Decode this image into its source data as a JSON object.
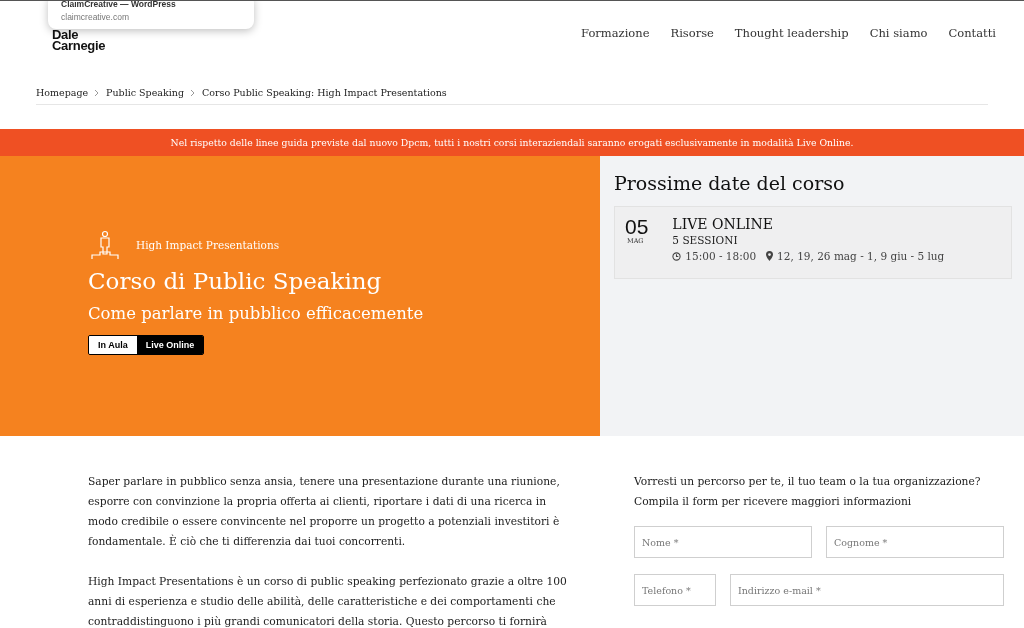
{
  "tooltip": {
    "title": "ClaimCreative — WordPress",
    "url": "claimcreative.com"
  },
  "logo": {
    "line_1": "Dale",
    "line_2": "Carnegie"
  },
  "nav": [
    "Formazione",
    "Risorse",
    "Thought leadership",
    "Chi siamo",
    "Contatti"
  ],
  "breadcrumb": [
    "Homepage",
    "Public Speaking",
    "Corso Public Speaking: High Impact Presentations"
  ],
  "notice": "Nel rispetto delle linee guida previste dal nuovo Dpcm, tutti i nostri corsi interaziendali saranno erogati esclusivamente in modalità Live Online.",
  "hero": {
    "program": "High Impact Presentations",
    "title": "Corso di Public Speaking",
    "subtitle": "Come parlare in pubblico efficacemente",
    "modes": [
      {
        "label": "In Aula",
        "selected": false
      },
      {
        "label": "Live Online",
        "selected": true
      }
    ]
  },
  "dates": {
    "title": "Prossime date del corso",
    "items": [
      {
        "day": "05",
        "month": "MAG",
        "format": "LIVE ONLINE",
        "sessions": "5 SESSIONI",
        "time": "15:00 - 18:00",
        "schedule": "12, 19, 26 mag - 1, 9 giu - 5 lug"
      }
    ]
  },
  "body": [
    "Saper parlare in pubblico senza ansia, tenere una presentazione durante una riunione, esporre con convinzione la propria offerta ai clienti, riportare i dati di una ricerca in modo credibile o essere convincente nel proporre un progetto a potenziali investitori è fondamentale. È ciò che ti differenzia dai tuoi concorrenti.",
    "High Impact Presentations è un corso di public speaking perfezionato grazie a oltre 100 anni di esperienza e studio delle abilità, delle caratteristiche e dei comportamenti che contraddistinguono i più grandi comunicatori della storia. Questo percorso ti fornirà"
  ],
  "form": {
    "intro_1": "Vorresti un percorso per te, il tuo team o la tua organizzazione?",
    "intro_2": "Compila il form per ricevere maggiori informazioni",
    "rows": [
      [
        {
          "placeholder": "Nome *"
        },
        {
          "placeholder": "Cognome *"
        }
      ],
      [
        {
          "placeholder": "Telefono *"
        },
        {
          "placeholder": "Indirizzo e-mail *"
        }
      ]
    ]
  }
}
